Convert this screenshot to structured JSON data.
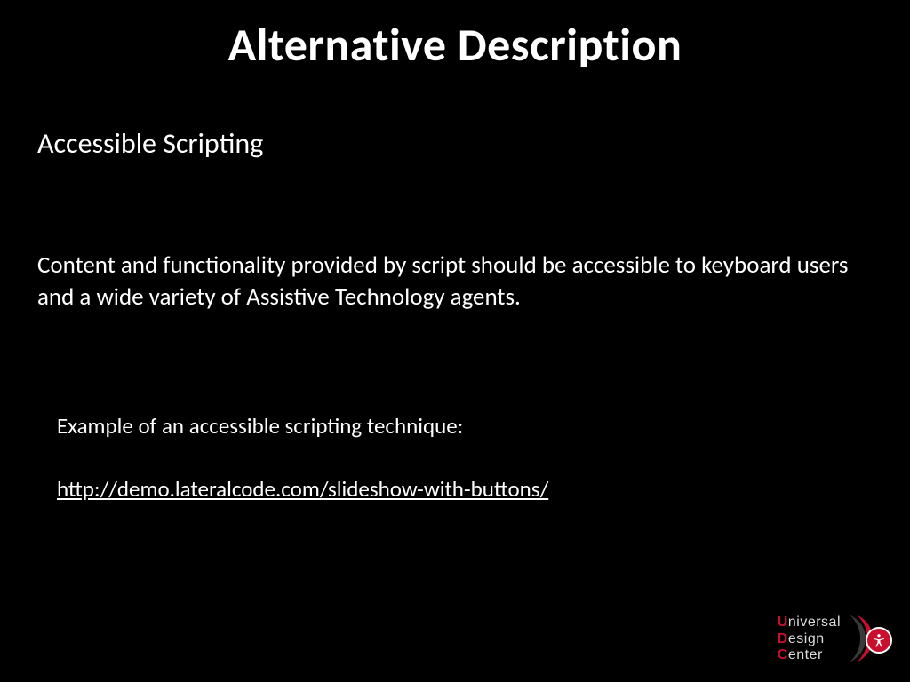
{
  "title": "Alternative Description",
  "subtitle": "Accessible Scripting",
  "body": "Content and functionality provided by script should be accessible to keyboard users and a wide variety of Assistive Technology agents.",
  "example_label": "Example of an accessible scripting technique:",
  "example_link": "http://demo.lateralcode.com/slideshow-with-buttons/",
  "logo": {
    "line1_letter": "U",
    "line1_rest": "niversal",
    "line2_letter": "D",
    "line2_rest": "esign",
    "line3_letter": "C",
    "line3_rest": "enter"
  }
}
